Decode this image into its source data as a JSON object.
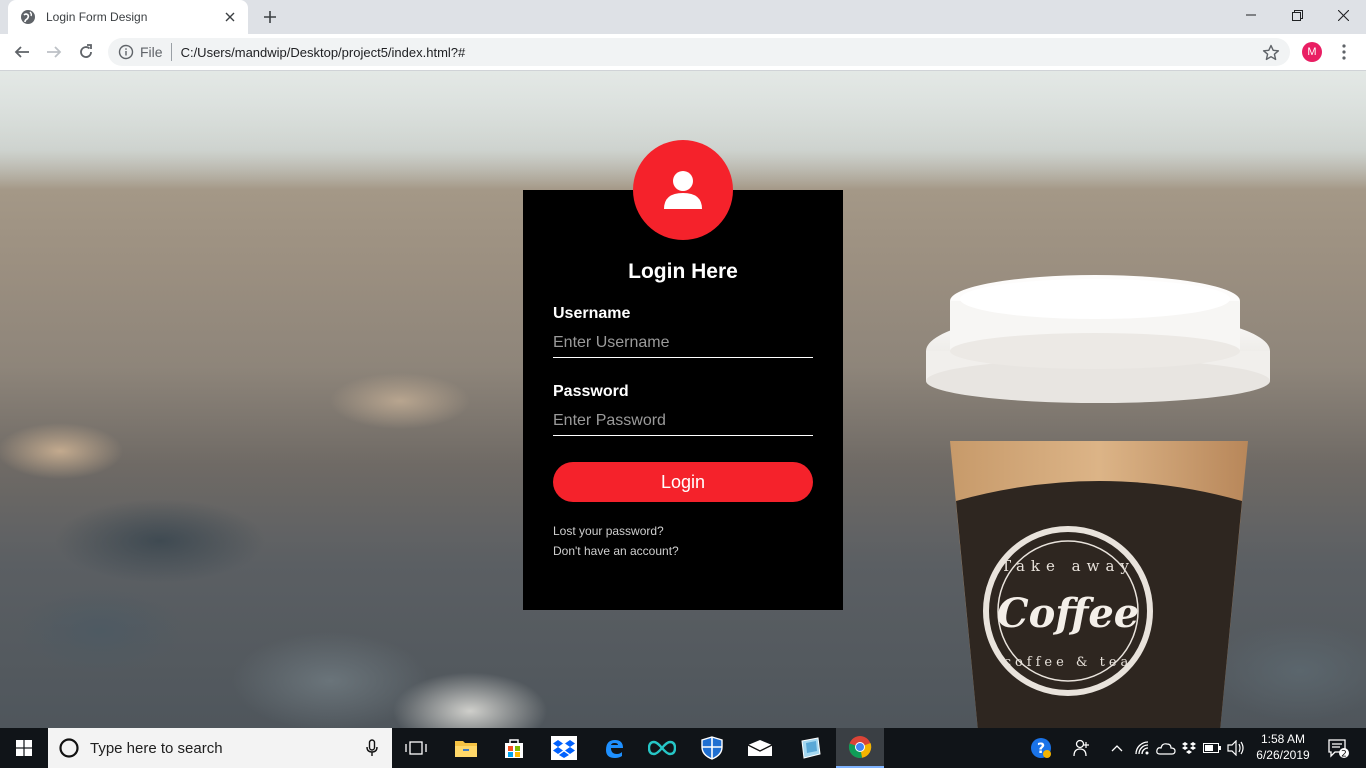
{
  "browser": {
    "tab_title": "Login Form Design",
    "url_scheme": "File",
    "url": "C:/Users/mandwip/Desktop/project5/index.html?#",
    "profile_initial": "M"
  },
  "login": {
    "title": "Login Here",
    "username_label": "Username",
    "username_placeholder": "Enter Username",
    "password_label": "Password",
    "password_placeholder": "Enter Password",
    "submit_label": "Login",
    "lost_password_link": "Lost your password?",
    "signup_link": "Don't have an account?"
  },
  "cup": {
    "line1": "Take away",
    "line2": "Coffee",
    "line3": "coffee & tea"
  },
  "taskbar": {
    "search_placeholder": "Type here to search",
    "time": "1:58 AM",
    "date": "6/26/2019",
    "notification_count": "2"
  },
  "colors": {
    "accent": "#f5222b",
    "panel": "#000000"
  }
}
